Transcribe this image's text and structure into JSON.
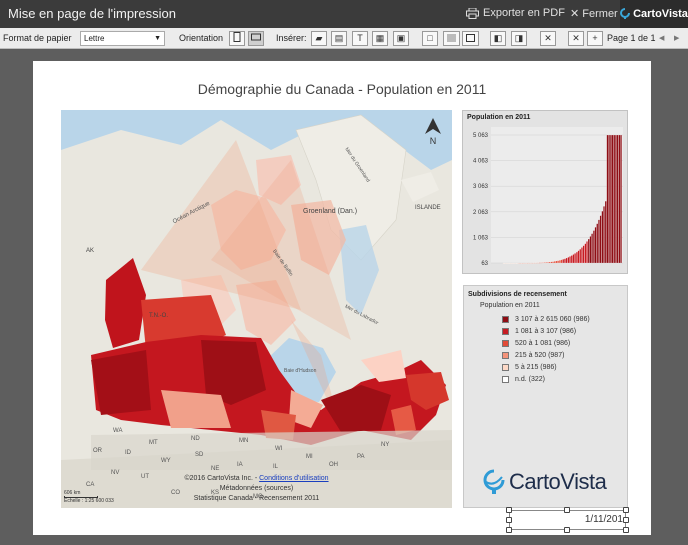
{
  "window": {
    "title": "Mise en page de l'impression",
    "export_pdf_label": "Exporter en PDF",
    "close_label": "Fermer",
    "brand_label": "CartoVista"
  },
  "toolbar": {
    "paper_format_label": "Format de papier",
    "paper_format_value": "Lettre",
    "orientation_label": "Orientation",
    "insert_label": "Insérer:",
    "page_indicator": "Page 1 de 1"
  },
  "page": {
    "title": "Démographie du Canada - Population en 2011",
    "map": {
      "credits_line1": "©2016 CartoVista Inc. - ",
      "credits_link": "Conditions d'utilisation",
      "credits_line2": "Métadonnées (sources)",
      "credits_line3": "Statistique Canada - Recensement 2011",
      "scale_line1": "606 km",
      "scale_line2": "Échelle : 1:25 600 033",
      "north_label": "N",
      "place_labels": [
        "Océan Arctique",
        "Groenland (Dan.)",
        "ISLANDE",
        "Mer du Groenland",
        "Baie de Baffin",
        "Mer du Labrador",
        "Baie d'Hudson",
        "T.N.-O.",
        "AK",
        "WA",
        "MT",
        "ND",
        "ID",
        "WY",
        "SD",
        "NE",
        "IA",
        "IL",
        "UT",
        "CO",
        "KS",
        "MO",
        "NV",
        "CA",
        "OR",
        "MN",
        "WI",
        "MI",
        "OH",
        "PA",
        "NY"
      ]
    },
    "chart": {
      "title": "Population en 2011",
      "y_ticks": [
        "5 063",
        "4 063",
        "3 063",
        "2 063",
        "1 063",
        "63"
      ]
    },
    "legend": {
      "title": "Subdivisions de recensement",
      "subtitle": "Population en 2011",
      "items": [
        {
          "label": "3 107 à 2 615 060 (986)",
          "color": "#8e0d14"
        },
        {
          "label": "1 081 à 3 107 (986)",
          "color": "#c71b22"
        },
        {
          "label": "520 à 1 081 (986)",
          "color": "#e24b37"
        },
        {
          "label": "215 à 520 (987)",
          "color": "#f4937a"
        },
        {
          "label": "5 à 215 (986)",
          "color": "#fcd8c6"
        },
        {
          "label": "n.d. (322)",
          "color": "#ffffff"
        }
      ],
      "logo_text": "CartoVista"
    },
    "date_text": "1/11/201"
  }
}
